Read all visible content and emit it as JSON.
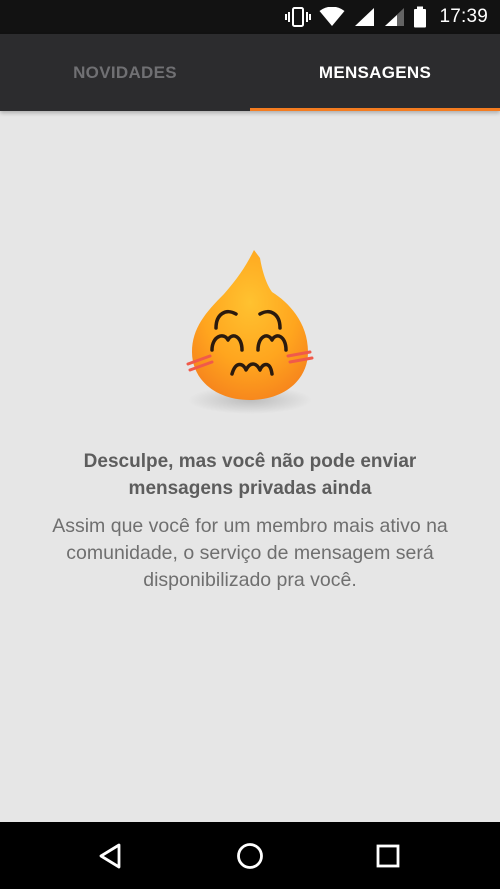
{
  "status_bar": {
    "time": "17:39",
    "icons": [
      "vibrate-icon",
      "wifi-icon",
      "signal-icon",
      "signal-icon",
      "battery-icon"
    ]
  },
  "tabs": [
    {
      "label": "NOVIDADES",
      "active": false
    },
    {
      "label": "MENSAGENS",
      "active": true
    }
  ],
  "empty_state": {
    "mascot_icon": "flame-mascot-icon",
    "title": "Desculpe, mas você não pode enviar mensagens privadas ainda",
    "message": "Assim que você for um membro mais ativo na comunidade, o serviço de mensagem será disponibilizado pra você."
  },
  "nav_bar": {
    "icons": [
      "back-icon",
      "home-icon",
      "recents-icon"
    ]
  },
  "colors": {
    "accent": "#f47c20",
    "tab_bar": "#2c2c2e",
    "background": "#e6e6e6",
    "status_bar": "#121212"
  }
}
